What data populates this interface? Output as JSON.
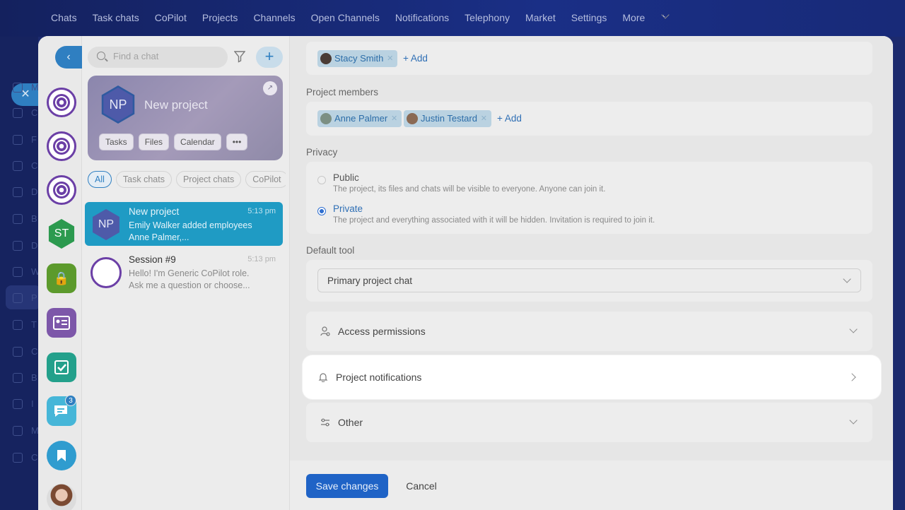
{
  "topnav": {
    "items": [
      "Chats",
      "Task chats",
      "CoPilot",
      "Projects",
      "Channels",
      "Open Channels",
      "Notifications",
      "Telephony",
      "Market",
      "Settings",
      "More"
    ]
  },
  "bgrail": {
    "letters": [
      "M",
      "C",
      "F",
      "C",
      "D",
      "B",
      "D",
      "W",
      "P",
      "T",
      "C",
      "B",
      "I",
      "M",
      "C"
    ]
  },
  "rail": {
    "st_label": "ST",
    "badge_count": "3"
  },
  "chatlist": {
    "search_placeholder": "Find a chat",
    "project_card": {
      "initials": "NP",
      "title": "New project",
      "buttons": [
        "Tasks",
        "Files",
        "Calendar",
        "•••"
      ]
    },
    "filters": [
      "All",
      "Task chats",
      "Project chats",
      "CoPilot"
    ],
    "chats": [
      {
        "initials": "NP",
        "name": "New project",
        "time": "5:13 pm",
        "preview": "Emily Walker added employees Anne Palmer,..."
      },
      {
        "name": "Session #9",
        "time": "5:13 pm",
        "preview": "Hello! I'm Generic CoPilot role. Ask me a question or choose..."
      }
    ]
  },
  "form": {
    "owner_chip": "Stacy Smith",
    "add_label": "+ Add",
    "members_label": "Project members",
    "members": [
      "Anne Palmer",
      "Justin Testard"
    ],
    "privacy_label": "Privacy",
    "privacy_options": [
      {
        "title": "Public",
        "desc": "The project, its files and chats will be visible to everyone. Anyone can join it."
      },
      {
        "title": "Private",
        "desc": "The project and everything associated with it will be hidden. Invitation is required to join it."
      }
    ],
    "default_tool_label": "Default tool",
    "default_tool_value": "Primary project chat",
    "sections": [
      "Access permissions",
      "Project notifications",
      "Other"
    ],
    "save_label": "Save changes",
    "cancel_label": "Cancel"
  },
  "colors": {
    "accent": "#2f7fc1",
    "primary_button": "#1f63c6",
    "selected_chat": "#1f9bc4"
  }
}
